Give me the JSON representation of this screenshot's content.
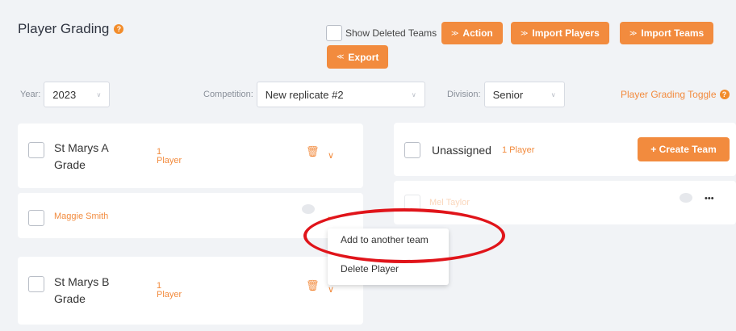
{
  "header": {
    "title": "Player Grading",
    "help_icon": "?",
    "show_deleted_label": "Show Deleted Teams",
    "buttons": {
      "action": "Action",
      "import_players": "Import Players",
      "import_teams": "Import Teams",
      "export": "Export"
    }
  },
  "filters": {
    "year_label": "Year:",
    "year_value": "2023",
    "competition_label": "Competition:",
    "competition_value": "New replicate #2",
    "division_label": "Division:",
    "division_value": "Senior",
    "toggle_label": "Player Grading Toggle"
  },
  "left_column": {
    "team1": {
      "name_line1": "St Marys A",
      "name_line2": "Grade",
      "count_line1": "1",
      "count_line2": "Player"
    },
    "player1": {
      "name": "Maggie Smith"
    },
    "team2": {
      "name_line1": "St Marys B",
      "name_line2": "Grade",
      "count_line1": "1",
      "count_line2": "Player"
    }
  },
  "right_column": {
    "unassigned_label": "Unassigned",
    "unassigned_count": "1 Player",
    "create_team_button": "+ Create Team",
    "player": {
      "name": "Mel Taylor",
      "more": "•••"
    }
  },
  "context_menu": {
    "items": [
      "Add to another team",
      "Delete Player"
    ]
  },
  "colors": {
    "accent": "#f28b3e",
    "highlight": "#e0141a"
  }
}
